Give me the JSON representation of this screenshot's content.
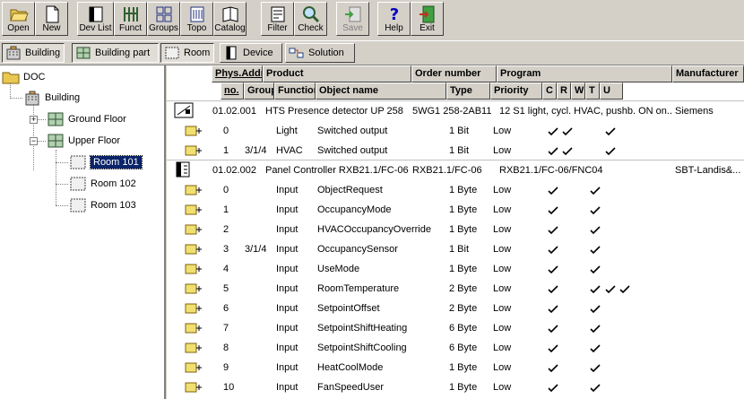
{
  "toolbar": {
    "buttons": [
      {
        "label": "Open",
        "icon": "folder-open-icon"
      },
      {
        "label": "New",
        "icon": "new-document-icon"
      },
      {
        "label": "Dev List",
        "icon": "device-list-icon"
      },
      {
        "label": "Funct",
        "icon": "function-icon"
      },
      {
        "label": "Groups",
        "icon": "groups-icon"
      },
      {
        "label": "Topo",
        "icon": "topology-icon"
      },
      {
        "label": "Catalog",
        "icon": "catalog-icon"
      },
      {
        "label": "Filter",
        "icon": "filter-icon"
      },
      {
        "label": "Check",
        "icon": "magnifier-icon"
      },
      {
        "label": "Save",
        "icon": "save-icon"
      },
      {
        "label": "Help",
        "icon": "help-icon"
      },
      {
        "label": "Exit",
        "icon": "exit-icon"
      }
    ]
  },
  "views": {
    "building": "Building",
    "building_part": "Building part",
    "room": "Room",
    "device": "Device",
    "solution": "Solution"
  },
  "tree": {
    "root": "DOC",
    "building": "Building",
    "ground_floor": "Ground Floor",
    "upper_floor": "Upper Floor",
    "rooms": [
      "Room 101",
      "Room 102",
      "Room 103"
    ]
  },
  "grid": {
    "headers_top": {
      "phys_addr": "Phys.Addr",
      "product": "Product",
      "order_number": "Order number",
      "program": "Program",
      "manufacturer": "Manufacturer"
    },
    "headers_sub": {
      "no": "no.",
      "group": "Group",
      "function": "Function",
      "object_name": "Object name",
      "type": "Type",
      "priority": "Priority",
      "c": "C",
      "r": "R",
      "w": "W",
      "t": "T",
      "u": "U"
    },
    "devices": [
      {
        "phys_addr": "01.02.001",
        "product": "HTS Presence detector UP 258",
        "order_number": "5WG1 258-2AB11",
        "program": "12 S1 light, cycl. HVAC, pushb. ON on...",
        "manufacturer": "Siemens",
        "objects": [
          {
            "no": "0",
            "group": "",
            "function": "Light",
            "name": "Switched output",
            "type": "1 Bit",
            "priority": "Low",
            "flags": [
              true,
              true,
              false,
              true,
              false
            ]
          },
          {
            "no": "1",
            "group": "3/1/4",
            "function": "HVAC",
            "name": "Switched output",
            "type": "1 Bit",
            "priority": "Low",
            "flags": [
              true,
              true,
              false,
              true,
              false
            ]
          }
        ]
      },
      {
        "phys_addr": "01.02.002",
        "product": "Panel Controller RXB21.1/FC-06",
        "order_number": "RXB21.1/FC-06",
        "program": "RXB21.1/FC-06/FNC04",
        "manufacturer": "SBT-Landis&...",
        "objects": [
          {
            "no": "0",
            "group": "",
            "function": "Input",
            "name": "ObjectRequest",
            "type": "1 Byte",
            "priority": "Low",
            "flags": [
              true,
              false,
              true,
              false,
              false
            ]
          },
          {
            "no": "1",
            "group": "",
            "function": "Input",
            "name": "OccupancyMode",
            "type": "1 Byte",
            "priority": "Low",
            "flags": [
              true,
              false,
              true,
              false,
              false
            ]
          },
          {
            "no": "2",
            "group": "",
            "function": "Input",
            "name": "HVACOccupancyOverride",
            "type": "1 Byte",
            "priority": "Low",
            "flags": [
              true,
              false,
              true,
              false,
              false
            ]
          },
          {
            "no": "3",
            "group": "3/1/4",
            "function": "Input",
            "name": "OccupancySensor",
            "type": "1 Bit",
            "priority": "Low",
            "flags": [
              true,
              false,
              true,
              false,
              false
            ]
          },
          {
            "no": "4",
            "group": "",
            "function": "Input",
            "name": "UseMode",
            "type": "1 Byte",
            "priority": "Low",
            "flags": [
              true,
              false,
              true,
              false,
              false
            ]
          },
          {
            "no": "5",
            "group": "",
            "function": "Input",
            "name": "RoomTemperature",
            "type": "2 Byte",
            "priority": "Low",
            "flags": [
              true,
              false,
              true,
              true,
              true
            ]
          },
          {
            "no": "6",
            "group": "",
            "function": "Input",
            "name": "SetpointOffset",
            "type": "2 Byte",
            "priority": "Low",
            "flags": [
              true,
              false,
              true,
              false,
              false
            ]
          },
          {
            "no": "7",
            "group": "",
            "function": "Input",
            "name": "SetpointShiftHeating",
            "type": "6 Byte",
            "priority": "Low",
            "flags": [
              true,
              false,
              true,
              false,
              false
            ]
          },
          {
            "no": "8",
            "group": "",
            "function": "Input",
            "name": "SetpointShiftCooling",
            "type": "6 Byte",
            "priority": "Low",
            "flags": [
              true,
              false,
              true,
              false,
              false
            ]
          },
          {
            "no": "9",
            "group": "",
            "function": "Input",
            "name": "HeatCoolMode",
            "type": "1 Byte",
            "priority": "Low",
            "flags": [
              true,
              false,
              true,
              false,
              false
            ]
          },
          {
            "no": "10",
            "group": "",
            "function": "Input",
            "name": "FanSpeedUser",
            "type": "1 Byte",
            "priority": "Low",
            "flags": [
              true,
              false,
              true,
              false,
              false
            ]
          }
        ]
      }
    ]
  }
}
